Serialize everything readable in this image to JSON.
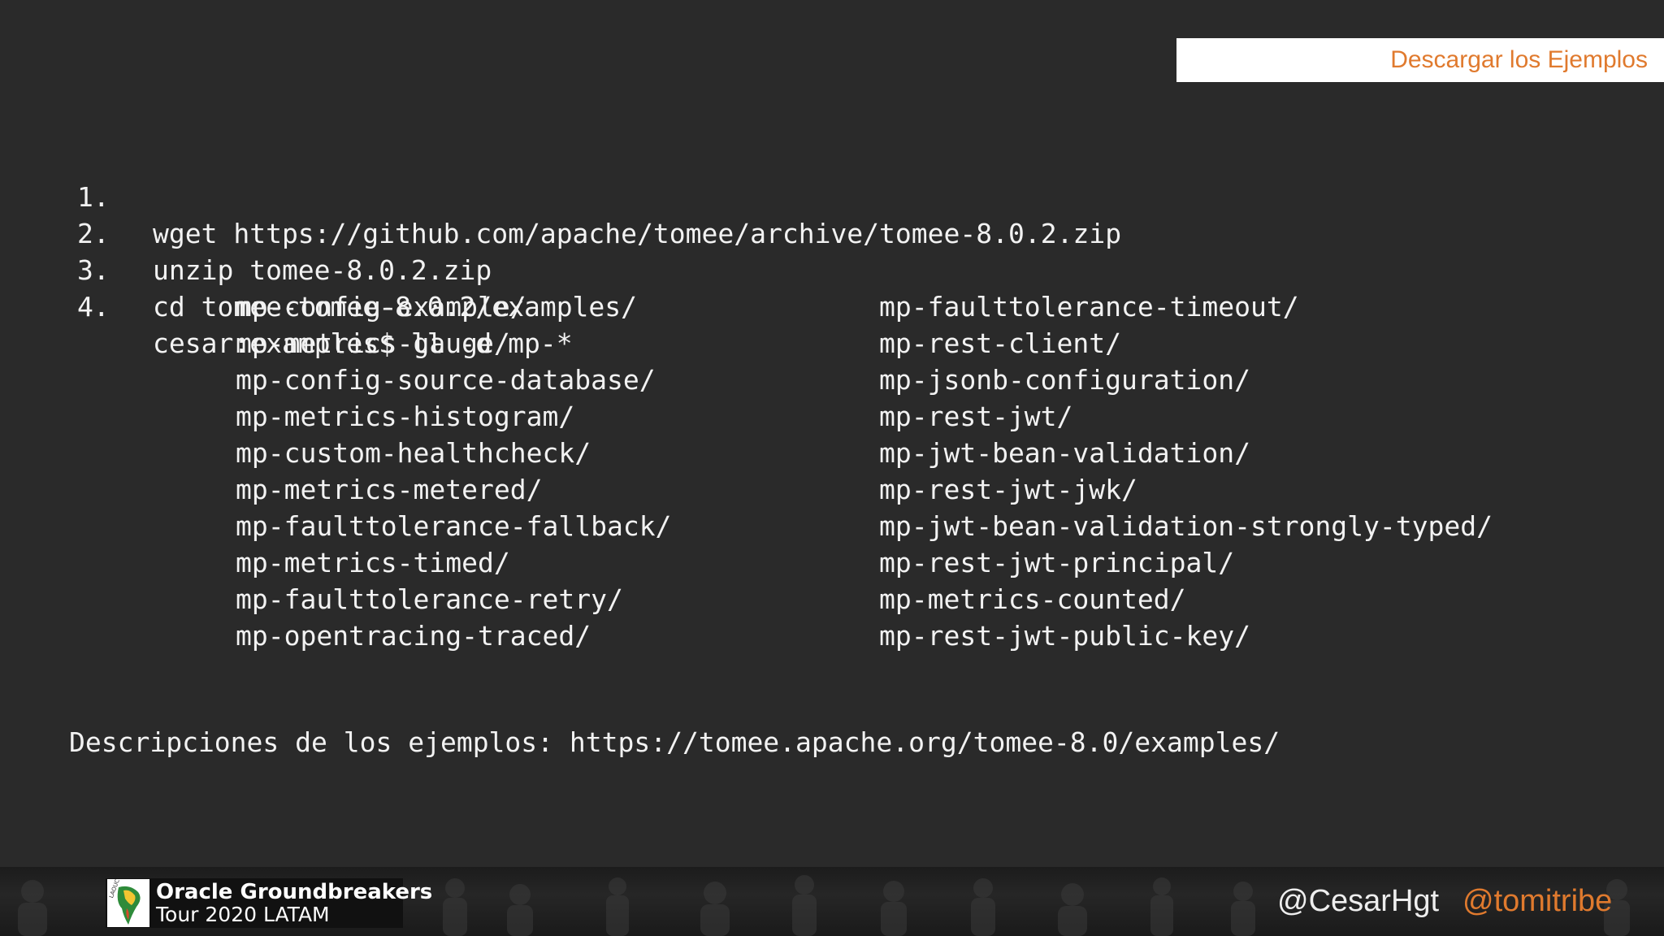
{
  "slide": {
    "title": "Descargar los Ejemplos",
    "steps": [
      {
        "num": "1.",
        "cmd": "wget https://github.com/apache/tomee/archive/tomee-8.0.2.zip"
      },
      {
        "num": "2.",
        "cmd": "unzip tomee-8.0.2.zip"
      },
      {
        "num": "3.",
        "cmd": "cd tomee-tomee-8.0.2/examples/"
      },
      {
        "num": "4.",
        "cmd": "cesar:examples$ ll -d mp-*"
      }
    ],
    "dirs_left": [
      "mp-config-example/",
      "mp-metrics-gauge/",
      "mp-config-source-database/",
      "mp-metrics-histogram/",
      "mp-custom-healthcheck/",
      "mp-metrics-metered/",
      "mp-faulttolerance-fallback/",
      "mp-metrics-timed/",
      "mp-faulttolerance-retry/",
      "mp-opentracing-traced/"
    ],
    "dirs_right": [
      "mp-faulttolerance-timeout/",
      "mp-rest-client/",
      "mp-jsonb-configuration/",
      "mp-rest-jwt/",
      "mp-jwt-bean-validation/",
      "mp-rest-jwt-jwk/",
      "mp-jwt-bean-validation-strongly-typed/",
      "mp-rest-jwt-principal/",
      "mp-metrics-counted/",
      "mp-rest-jwt-public-key/"
    ],
    "description": "Descripciones de los ejemplos: https://tomee.apache.org/tomee-8.0/examples/"
  },
  "footer": {
    "logo_line1": "Oracle Groundbreakers",
    "logo_line2": "Tour 2020 LATAM",
    "logo_mark_text": "LAOUC",
    "handle_1": "@CesarHgt",
    "handle_2": "@tomitribe"
  },
  "colors": {
    "background": "#2a2a2a",
    "accent": "#e07a2e",
    "text": "#f2f2f2",
    "title_bar": "#ffffff"
  }
}
